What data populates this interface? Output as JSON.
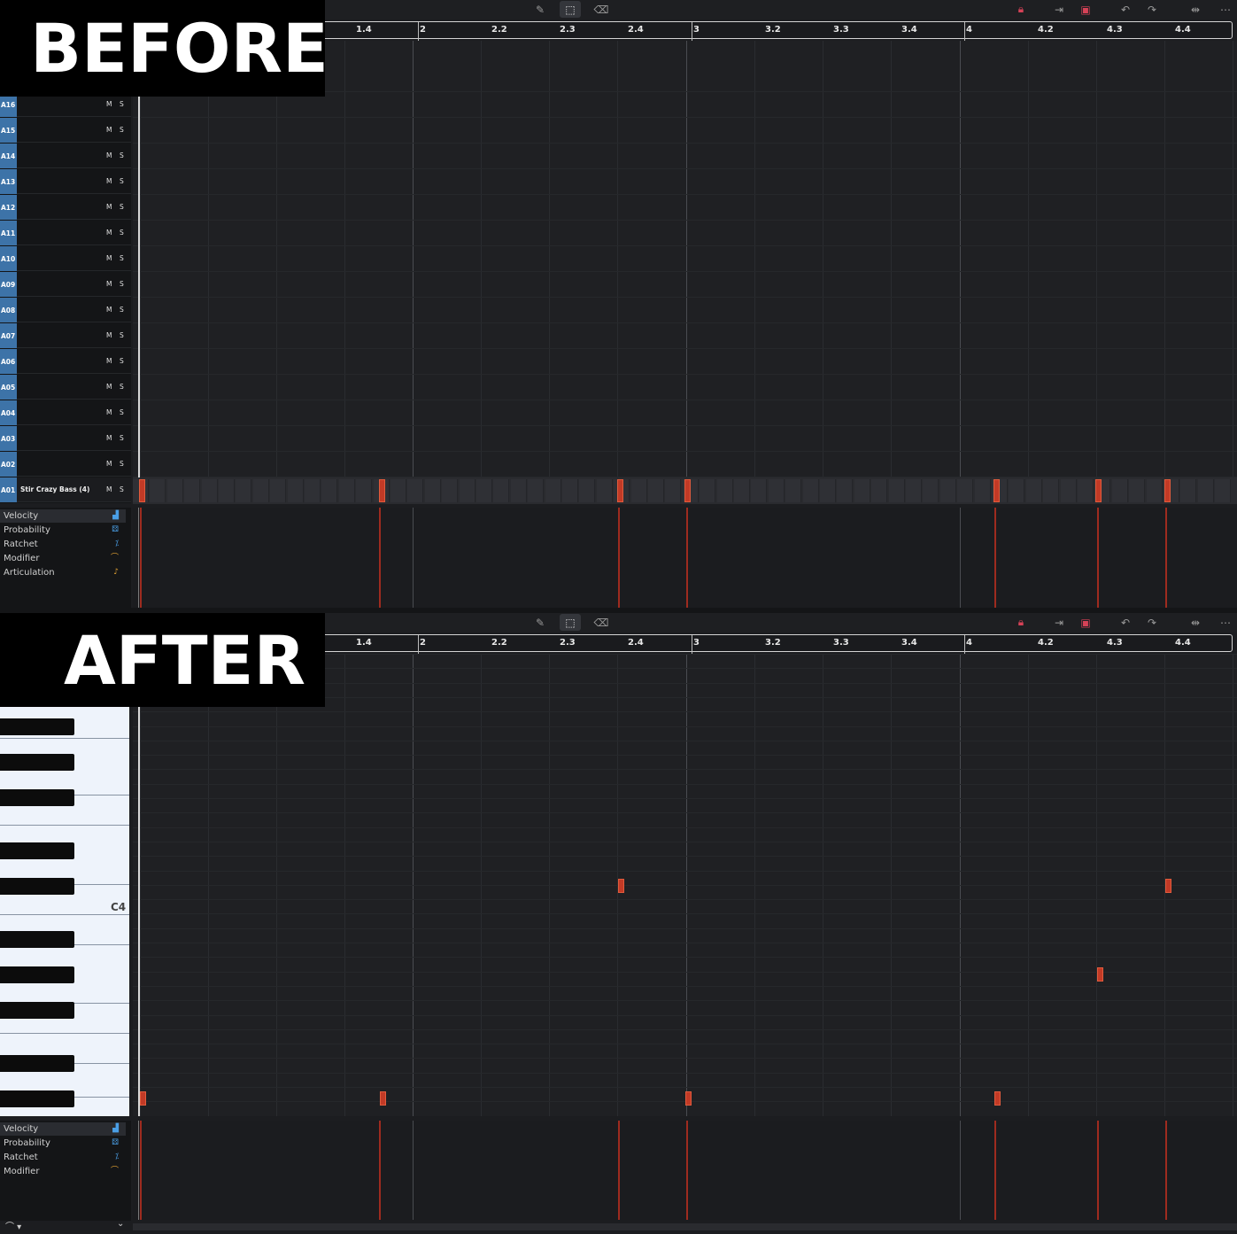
{
  "labels": {
    "before": "BEFORE",
    "after": "AFTER"
  },
  "toolbar": {
    "icons": [
      "pencil-icon",
      "select-icon",
      "eraser-icon",
      "lock-icon",
      "snap-icon",
      "loop-icon",
      "undo-icon",
      "redo-icon",
      "zoom-icon",
      "more-icon"
    ]
  },
  "ruler": {
    "ticks": [
      "1.4",
      "2",
      "2.2",
      "2.3",
      "2.4",
      "3",
      "3.2",
      "3.3",
      "3.4",
      "4",
      "4.2",
      "4.3",
      "4.4"
    ]
  },
  "tracks": [
    {
      "id": "A16",
      "name": ""
    },
    {
      "id": "A15",
      "name": ""
    },
    {
      "id": "A14",
      "name": ""
    },
    {
      "id": "A13",
      "name": ""
    },
    {
      "id": "A12",
      "name": ""
    },
    {
      "id": "A11",
      "name": ""
    },
    {
      "id": "A10",
      "name": ""
    },
    {
      "id": "A09",
      "name": ""
    },
    {
      "id": "A08",
      "name": ""
    },
    {
      "id": "A07",
      "name": ""
    },
    {
      "id": "A06",
      "name": ""
    },
    {
      "id": "A05",
      "name": ""
    },
    {
      "id": "A04",
      "name": ""
    },
    {
      "id": "A03",
      "name": ""
    },
    {
      "id": "A02",
      "name": ""
    },
    {
      "id": "A01",
      "name": "Stir Crazy Bass  (4)"
    }
  ],
  "mute_label": "M",
  "solo_label": "S",
  "lanes_before": [
    "Velocity",
    "Probability",
    "Ratchet",
    "Modifier",
    "Articulation"
  ],
  "lanes_after": [
    "Velocity",
    "Probability",
    "Ratchet",
    "Modifier"
  ],
  "piano": {
    "c4_label": "C4"
  },
  "colors": {
    "note": "#c23a26",
    "track_id": "#3d73a8",
    "lock": "#d64257"
  }
}
